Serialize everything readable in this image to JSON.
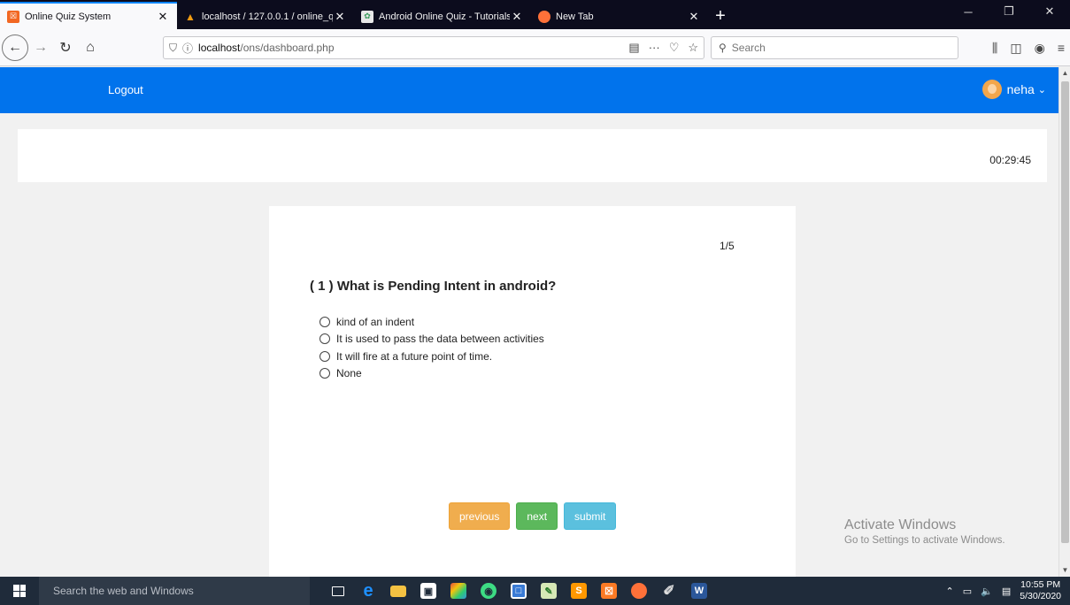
{
  "browser": {
    "tabs": [
      {
        "title": "Online Quiz System",
        "icon": "quiz-favicon",
        "color": "#f26722",
        "active": true
      },
      {
        "title": "localhost / 127.0.0.1 / online_q",
        "icon": "phpmyadmin-favicon",
        "color": "#f39c12",
        "active": false
      },
      {
        "title": "Android Online Quiz - Tutorials",
        "icon": "tutorials-favicon",
        "color": "#3a9b5c",
        "active": false
      },
      {
        "title": "New Tab",
        "icon": "firefox-favicon",
        "color": "#ff7139",
        "active": false
      }
    ],
    "url_host": "localhost",
    "url_path": "/ons/dashboard.php",
    "search_placeholder": "Search"
  },
  "app": {
    "logout_label": "Logout",
    "username": "neha",
    "timer": "00:29:45",
    "brand_color": "#0173ec"
  },
  "quiz": {
    "counter": "1/5",
    "question": "( 1 ) What is Pending Intent in android?",
    "options": [
      "kind of an indent",
      "It is used to pass the data between activities",
      "It will fire at a future point of time.",
      "None"
    ],
    "buttons": {
      "previous": "previous",
      "next": "next",
      "submit": "submit"
    }
  },
  "watermark": {
    "line1": "Activate Windows",
    "line2": "Go to Settings to activate Windows."
  },
  "taskbar": {
    "search_placeholder": "Search the web and Windows",
    "time": "10:55 PM",
    "date": "5/30/2020"
  }
}
